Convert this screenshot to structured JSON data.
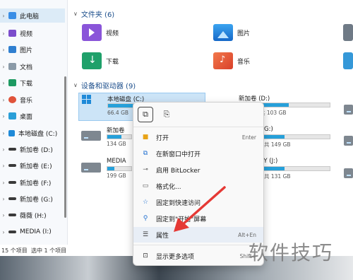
{
  "sidebar": {
    "items": [
      {
        "label": "此电脑",
        "icon": "monitor-icon",
        "selected": true
      },
      {
        "label": "视频",
        "icon": "video-icon"
      },
      {
        "label": "图片",
        "icon": "pictures-icon"
      },
      {
        "label": "文档",
        "icon": "documents-icon"
      },
      {
        "label": "下载",
        "icon": "download-icon"
      },
      {
        "label": "音乐",
        "icon": "music-icon"
      },
      {
        "label": "桌面",
        "icon": "desktop-icon"
      },
      {
        "label": "本地磁盘 (C:)",
        "icon": "drive-icon"
      },
      {
        "label": "新加卷 (D:)",
        "icon": "drive-icon"
      },
      {
        "label": "新加卷 (E:)",
        "icon": "drive-icon"
      },
      {
        "label": "新加卷 (F:)",
        "icon": "drive-icon"
      },
      {
        "label": "新加卷 (G:)",
        "icon": "drive-icon"
      },
      {
        "label": "薇薇 (H:)",
        "icon": "drive-icon"
      },
      {
        "label": "MEDIA (I:)",
        "icon": "drive-icon"
      }
    ]
  },
  "folders": {
    "header": "文件夹 (6)",
    "items": [
      "视频",
      "图片",
      "下载",
      "音乐"
    ]
  },
  "drives": {
    "header": "设备和驱动器 (9)",
    "items": [
      {
        "name": "本地磁盘 (C:)",
        "info": "66.4 GB",
        "used": 0.62,
        "selected": true
      },
      {
        "name": "新加卷 (D:)",
        "info": "共 103 GB",
        "used": 0.55
      },
      {
        "name": "新加卷",
        "info": "134 GB",
        "used": 0.2
      },
      {
        "name": "G:)",
        "info": "共 149 GB",
        "used": 0.5
      },
      {
        "name": "MEDIA",
        "info": "199 GB",
        "used": 0.3
      },
      {
        "name": "RY (J:)",
        "info": "共 131 GB",
        "used": 0.5
      }
    ]
  },
  "context_menu": {
    "top_icons": [
      "copy-icon",
      "rename-icon"
    ],
    "items": [
      {
        "label": "打开",
        "shortcut": "Enter",
        "icon": "folder-open-icon"
      },
      {
        "label": "在新窗口中打开",
        "shortcut": "",
        "icon": "new-window-icon"
      },
      {
        "label": "启用 BitLocker",
        "shortcut": "",
        "icon": "key-icon"
      },
      {
        "label": "格式化...",
        "shortcut": "",
        "icon": "format-icon"
      },
      {
        "label": "固定到快速访问",
        "shortcut": "",
        "icon": "star-icon"
      },
      {
        "label": "固定到\"开始\"屏幕",
        "shortcut": "",
        "icon": "pin-icon"
      },
      {
        "label": "属性",
        "shortcut": "Alt+En",
        "icon": "properties-icon"
      },
      {
        "label": "显示更多选项",
        "shortcut": "Shift+",
        "icon": "more-options-icon"
      }
    ]
  },
  "status": {
    "count": "15 个项目",
    "selected": "选中 1 个项目"
  },
  "watermark": "软件技巧",
  "colors": {
    "accent": "#26a0da",
    "arrow": "#e53935"
  }
}
